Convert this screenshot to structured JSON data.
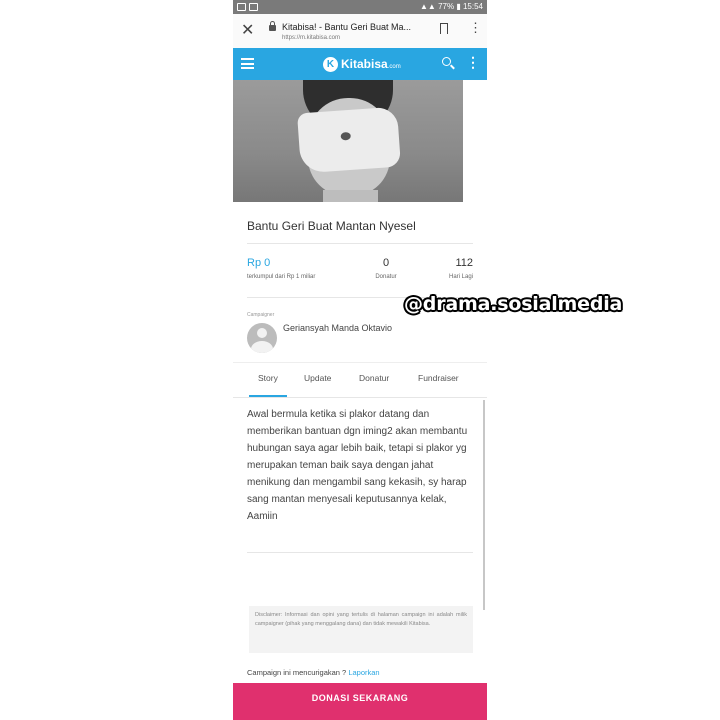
{
  "status_bar": {
    "battery": "77%",
    "time": "15:54"
  },
  "browser": {
    "tab_title": "Kitabisa! - Bantu Geri Buat Ma...",
    "url": "https://m.kitabisa.com",
    "icons": {
      "close": "close-icon",
      "lock": "lock-icon",
      "bookmark": "bookmark-icon",
      "menu": "more-vert-icon"
    }
  },
  "app_bar": {
    "brand": "Kitabisa",
    "brand_suffix": ".com",
    "logo_letter": "K",
    "accent_color": "#29a6e1",
    "icons": {
      "menu": "hamburger-icon",
      "search": "search-icon",
      "more": "more-vert-icon"
    }
  },
  "campaign": {
    "title": "Bantu Geri Buat Mantan Nyesel",
    "amount": "Rp 0",
    "amount_caption": "terkumpul dari Rp 1 miliar",
    "donors": "0",
    "donors_caption": "Donatur",
    "days_left": "112",
    "days_caption": "Hari Lagi"
  },
  "campaigner": {
    "label": "Campaigner",
    "name": "Geriansyah Manda Oktavio"
  },
  "tabs": [
    "Story",
    "Update",
    "Donatur",
    "Fundraiser"
  ],
  "active_tab": "Story",
  "story": "Awal bermula ketika si plakor datang dan memberikan bantuan dgn iming2 akan membantu hubungan saya agar lebih baik, tetapi si plakor yg merupakan teman baik saya dengan jahat menikung dan mengambil sang kekasih, sy harap sang mantan menyesali keputusannya kelak, Aamiin",
  "disclaimer": "Disclaimer: Informasi dan opini yang tertulis di halaman campaign ini adalah milik campaigner (pihak yang menggalang dana) dan tidak mewakili Kitabisa.",
  "report": {
    "question": "Campaign ini mencurigakan ?",
    "link": "Laporkan"
  },
  "donate_button": {
    "label": "DONASI SEKARANG",
    "color": "#e0306e"
  },
  "watermark": "@drama.sosialmedia"
}
